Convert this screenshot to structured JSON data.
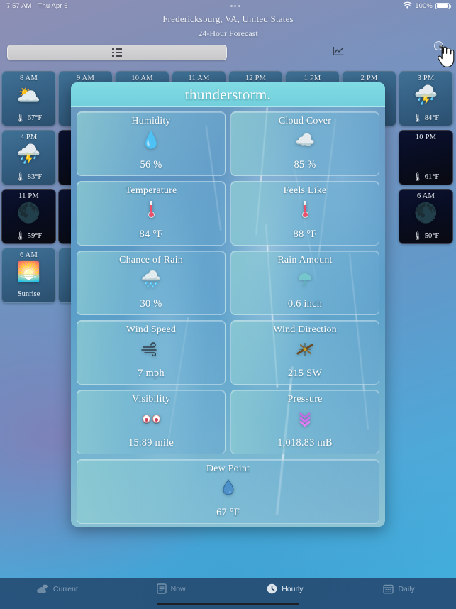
{
  "status_bar": {
    "time": "7:57 AM",
    "date": "Thu Apr 6",
    "wifi_icon": "wifi-icon",
    "battery_percent": "100%",
    "battery_icon": "battery-full-icon",
    "handle_icon": "multitask-handle-icon"
  },
  "header": {
    "location": "Fredericksburg, VA, United States",
    "subtitle": "24-Hour Forecast"
  },
  "toolbar": {
    "list_view_icon": "list-view-icon",
    "chart_view_icon": "line-chart-icon",
    "cursor_icon": "pointing-hand-cursor-icon"
  },
  "hours": [
    {
      "time": "8 AM",
      "icon": "partly-cloudy-icon",
      "glyph": "🌥️",
      "temp": "67°F",
      "night": false,
      "label": ""
    },
    {
      "time": "9 AM",
      "icon": "hidden-card",
      "glyph": "",
      "temp": "",
      "night": false,
      "label": ""
    },
    {
      "time": "10 AM",
      "icon": "hidden-card",
      "glyph": "",
      "temp": "",
      "night": false,
      "label": ""
    },
    {
      "time": "11 AM",
      "icon": "hidden-card",
      "glyph": "",
      "temp": "",
      "night": false,
      "label": ""
    },
    {
      "time": "12 PM",
      "icon": "hidden-card",
      "glyph": "",
      "temp": "",
      "night": false,
      "label": ""
    },
    {
      "time": "1 PM",
      "icon": "hidden-card",
      "glyph": "",
      "temp": "",
      "night": false,
      "label": ""
    },
    {
      "time": "2 PM",
      "icon": "hidden-card",
      "glyph": "",
      "temp": "",
      "night": false,
      "label": ""
    },
    {
      "time": "3 PM",
      "icon": "thunderstorm-icon",
      "glyph": "⛈️",
      "temp": "84°F",
      "night": false,
      "label": ""
    },
    {
      "time": "4 PM",
      "icon": "thunderstorm-icon",
      "glyph": "⛈️",
      "temp": "83°F",
      "night": false,
      "label": ""
    },
    {
      "time": "10 PM",
      "icon": "clear-night-icon",
      "glyph": "",
      "temp": "61°F",
      "night": true,
      "label": ""
    },
    {
      "time": "11 PM",
      "icon": "cloudy-night-icon",
      "glyph": "🌑",
      "temp": "59°F",
      "night": true,
      "label": ""
    },
    {
      "time": "6 AM",
      "icon": "cloudy-night-icon",
      "glyph": "🌑",
      "temp": "50°F",
      "night": true,
      "label": ""
    },
    {
      "time": "6 AM",
      "icon": "sunrise-icon",
      "glyph": "🌅",
      "temp": "",
      "night": false,
      "label": "Sunrise"
    }
  ],
  "modal": {
    "title": "thunderstorm.",
    "details": [
      {
        "label": "Humidity",
        "value": "56 %",
        "icon": "humidity-droplet-icon",
        "glyph": "💧"
      },
      {
        "label": "Cloud Cover",
        "value": "85 %",
        "icon": "cloud-icon",
        "glyph": "☁️"
      },
      {
        "label": "Temperature",
        "value": "84 °F",
        "icon": "thermometer-icon",
        "glyph": "🌡️"
      },
      {
        "label": "Feels Like",
        "value": "88 °F",
        "icon": "thermometer-icon",
        "glyph": "🌡️"
      },
      {
        "label": "Chance of Rain",
        "value": "30 %",
        "icon": "rain-cloud-icon",
        "glyph": "🌧️"
      },
      {
        "label": "Rain Amount",
        "value": "0.6 inch",
        "icon": "umbrella-icon",
        "glyph": "☂️"
      },
      {
        "label": "Wind Speed",
        "value": "7 mph",
        "icon": "wind-icon",
        "glyph": "🌬️"
      },
      {
        "label": "Wind Direction",
        "value": "215 SW",
        "icon": "compass-icon",
        "glyph": "🧭"
      },
      {
        "label": "Visibility",
        "value": "15.89 mile",
        "icon": "eyes-icon",
        "glyph": "👀"
      },
      {
        "label": "Pressure",
        "value": "1,018.83 mB",
        "icon": "pressure-down-icon",
        "glyph": "⏬"
      },
      {
        "label": "Dew Point",
        "value": "67 °F",
        "icon": "water-drop-icon",
        "glyph": "💧"
      }
    ]
  },
  "tabs": [
    {
      "label": "Current",
      "icon": "sun-cloud-icon",
      "active": false
    },
    {
      "label": "Now",
      "icon": "document-icon",
      "active": false
    },
    {
      "label": "Hourly",
      "icon": "clock-icon",
      "active": true
    },
    {
      "label": "Daily",
      "icon": "calendar-icon",
      "active": false
    }
  ],
  "colors": {
    "modal_header": "#7dd8e2",
    "tabbar": "#264c74",
    "card_night": "#0a0f26",
    "card_day": "#3a6a8e"
  }
}
